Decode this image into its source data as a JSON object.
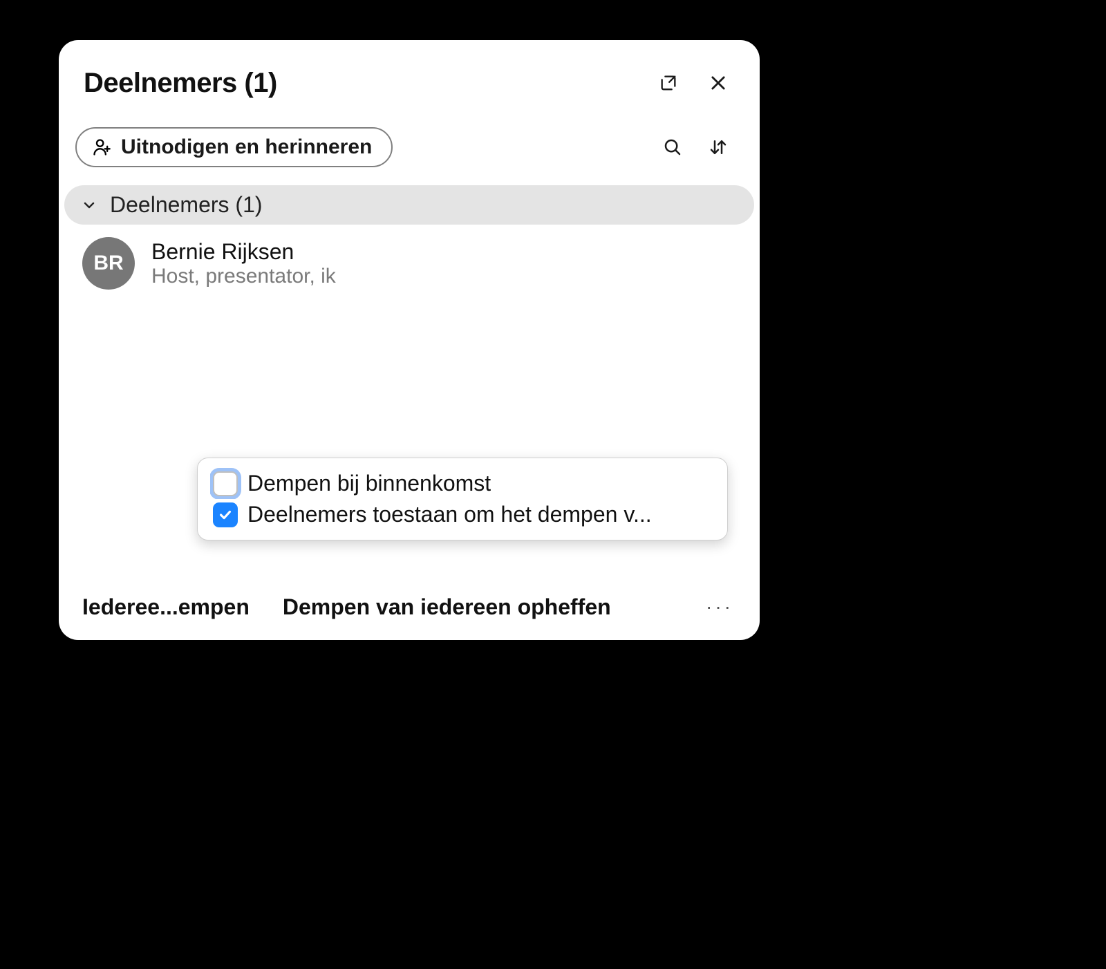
{
  "header": {
    "title": "Deelnemers (1)"
  },
  "toolbar": {
    "invite_label": "Uitnodigen en herinneren"
  },
  "section": {
    "label": "Deelnemers (1)"
  },
  "participants": [
    {
      "initials": "BR",
      "name": "Bernie Rijksen",
      "subtitle": "Host, presentator, ik"
    }
  ],
  "popup": {
    "option1": {
      "label": "Dempen bij binnenkomst",
      "checked": false
    },
    "option2": {
      "label": "Deelnemers toestaan om het dempen v...",
      "checked": true
    }
  },
  "footer": {
    "mute_all": "Iederee...empen",
    "unmute_all": "Dempen van iedereen opheffen"
  }
}
